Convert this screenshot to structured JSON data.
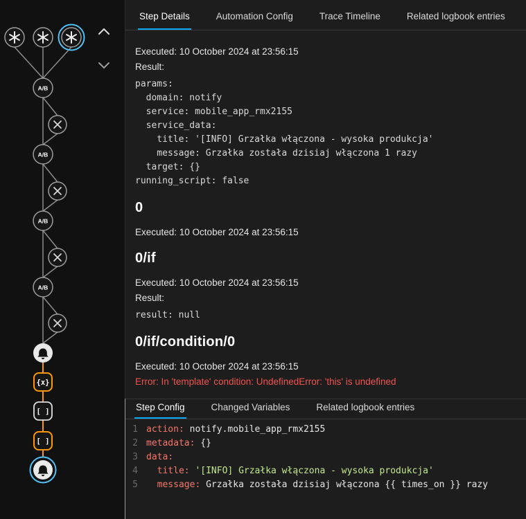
{
  "colors": {
    "accent_blue": "#03a9f4",
    "selected_ring_blue": "#4fc3f7",
    "path_orange": "#ff9800",
    "error_red": "#ef5350"
  },
  "graph": {
    "ab_label": "A/B",
    "variables_label": "{x}",
    "brackets_label": "[ ]"
  },
  "top_tabs": {
    "step_details": "Step Details",
    "automation_config": "Automation Config",
    "trace_timeline": "Trace Timeline",
    "related_logbook": "Related logbook entries"
  },
  "details": {
    "executed": "Executed: 10 October 2024 at 23:56:15",
    "result_label": "Result:",
    "code_block": "params:\n  domain: notify\n  service: mobile_app_rmx2155\n  service_data:\n    title: '[INFO] Grzałka włączona - wysoka produkcja'\n    message: Grzałka została dzisiaj włączona 1 razy\n  target: {}\nrunning_script: false",
    "heading_step0": "0",
    "heading_if": "0/if",
    "result_null": "result: null",
    "heading_condition": "0/if/condition/0",
    "error": "Error: In 'template' condition: UndefinedError: 'this' is undefined"
  },
  "bottom_tabs": {
    "step_config": "Step Config",
    "changed_variables": "Changed Variables",
    "related_logbook": "Related logbook entries"
  },
  "editor": {
    "lines": [
      {
        "num": "1",
        "key": "action:",
        "rest": " notify.mobile_app_rmx2155"
      },
      {
        "num": "2",
        "key": "metadata:",
        "rest": " {}"
      },
      {
        "num": "3",
        "key": "data:",
        "rest": ""
      },
      {
        "num": "4",
        "indent": "  ",
        "key": "title:",
        "string": " '[INFO] Grzałka włączona - wysoka produkcja'"
      },
      {
        "num": "5",
        "indent": "  ",
        "key": "message:",
        "rest": " Grzałka została dzisiaj włączona {{ times_on }} razy"
      }
    ]
  }
}
